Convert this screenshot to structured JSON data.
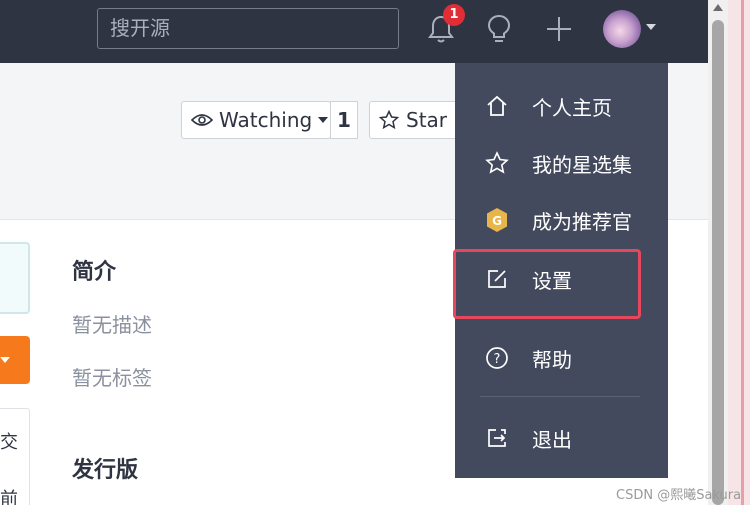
{
  "header": {
    "search_placeholder": "搜开源",
    "notification_count": "1",
    "icons": [
      "bell-icon",
      "lightbulb-icon",
      "plus-icon",
      "avatar",
      "caret-down-icon"
    ]
  },
  "repo": {
    "watching_label": "Watching",
    "watching_count": "1",
    "star_label": "Star"
  },
  "main": {
    "intro_title": "简介",
    "no_description": "暂无描述",
    "no_tags": "暂无标签",
    "releases_title": "发行版",
    "left_chars": [
      "交",
      "前"
    ]
  },
  "dropdown": {
    "items": [
      {
        "label": "个人主页",
        "icon": "home-icon"
      },
      {
        "label": "我的星选集",
        "icon": "star-icon"
      },
      {
        "label": "成为推荐官",
        "icon": "g-badge-icon"
      },
      {
        "label": "设置",
        "icon": "edit-icon"
      },
      {
        "label": "帮助",
        "icon": "help-circle-icon"
      },
      {
        "label": "退出",
        "icon": "logout-icon"
      }
    ],
    "highlighted": "设置"
  },
  "watermark": "CSDN @熙曦Sakura",
  "colors": {
    "header_bg": "#2e3442",
    "dropdown_bg": "#434a5e",
    "highlight_border": "#e6475c",
    "accent_orange": "#f6791c",
    "badge_red": "#e02d36"
  }
}
